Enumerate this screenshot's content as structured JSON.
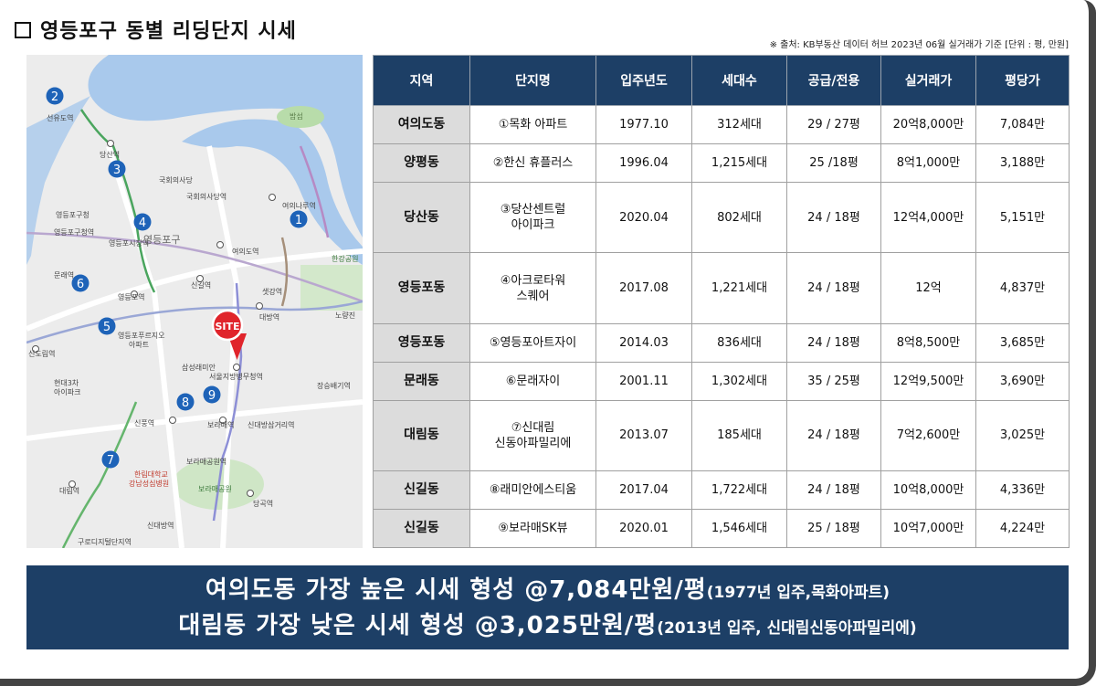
{
  "title": "영등포구 동별 리딩단지 시세",
  "source_note": "※ 출처: KB부동산 데이터 허브 2023년 06월 실거래가 기준   [단위 : 평, 만원]",
  "table": {
    "headers": [
      "지역",
      "단지명",
      "입주년도",
      "세대수",
      "공급/전용",
      "실거래가",
      "평당가"
    ],
    "rows": [
      {
        "region": "여의도동",
        "name": [
          "①목화 아파트"
        ],
        "year": "1977.10",
        "units": "312세대",
        "area": "29 / 27평",
        "price": "20억8,000만",
        "per_pyeong": "7,084만"
      },
      {
        "region": "양평동",
        "name": [
          "②한신 휴플러스"
        ],
        "year": "1996.04",
        "units": "1,215세대",
        "area": "25 /18평",
        "price": "8억1,000만",
        "per_pyeong": "3,188만"
      },
      {
        "region": "당산동",
        "name": [
          "③당산센트럴",
          "아이파크"
        ],
        "year": "2020.04",
        "units": "802세대",
        "area": "24 / 18평",
        "price": "12억4,000만",
        "per_pyeong": "5,151만"
      },
      {
        "region": "영등포동",
        "name": [
          "④아크로타워",
          "스퀘어"
        ],
        "year": "2017.08",
        "units": "1,221세대",
        "area": "24 / 18평",
        "price": "12억",
        "per_pyeong": "4,837만"
      },
      {
        "region": "영등포동",
        "name": [
          "⑤영등포아트자이"
        ],
        "year": "2014.03",
        "units": "836세대",
        "area": "24 / 18평",
        "price": "8억8,500만",
        "per_pyeong": "3,685만"
      },
      {
        "region": "문래동",
        "name": [
          "⑥문래자이"
        ],
        "year": "2001.11",
        "units": "1,302세대",
        "area": "35 / 25평",
        "price": "12억9,500만",
        "per_pyeong": "3,690만"
      },
      {
        "region": "대림동",
        "name": [
          "⑦신대림",
          "신동아파밀리에"
        ],
        "year": "2013.07",
        "units": "185세대",
        "area": "24 / 18평",
        "price": "7억2,600만",
        "per_pyeong": "3,025만"
      },
      {
        "region": "신길동",
        "name": [
          "⑧래미안에스티움"
        ],
        "year": "2017.04",
        "units": "1,722세대",
        "area": "24 / 18평",
        "price": "10억8,000만",
        "per_pyeong": "4,336만"
      },
      {
        "region": "신길동",
        "name": [
          "⑨보라매SK뷰"
        ],
        "year": "2020.01",
        "units": "1,546세대",
        "area": "25 / 18평",
        "price": "10억7,000만",
        "per_pyeong": "4,224만"
      }
    ]
  },
  "map": {
    "site_label": "SITE",
    "markers": [
      "1",
      "2",
      "3",
      "4",
      "5",
      "6",
      "7",
      "8",
      "9"
    ],
    "labels": [
      "선유도역",
      "당산역",
      "국회의사당",
      "국회의사당역",
      "여의나루역",
      "영등포구청",
      "영등포구청역",
      "영등포시장역",
      "영등포구",
      "여의도역",
      "신길역",
      "샛강역",
      "대방역",
      "노량진",
      "문래역",
      "영등포역",
      "영등포푸르지오",
      "아파트",
      "신도림역",
      "현대3차",
      "아이파크",
      "삼성래미안",
      "서울지방병무청역",
      "장승배기역",
      "신풍역",
      "보라매역",
      "신대방삼거리역",
      "보라매공원역",
      "한림대학교",
      "강남성심병원",
      "보라매공원",
      "대림역",
      "당곡역",
      "신대방역",
      "구로디지털단지역",
      "밤섬",
      "한강공원"
    ]
  },
  "summary": {
    "line1_main": "여의도동 가장 높은 시세 형성 @7,084만원/평",
    "line1_note": "(1977년 입주,목화아파트)",
    "line2_main": "대림동 가장 낮은 시세 형성 @3,025만원/평",
    "line2_note": "(2013년 입주, 신대림신동아파밀리에)"
  },
  "colors": {
    "header_navy": "#1d3f66",
    "region_gray": "#dcdcdc",
    "marker_blue": "#1e63b8",
    "site_red": "#e0242b",
    "river": "#a9c9ec"
  }
}
